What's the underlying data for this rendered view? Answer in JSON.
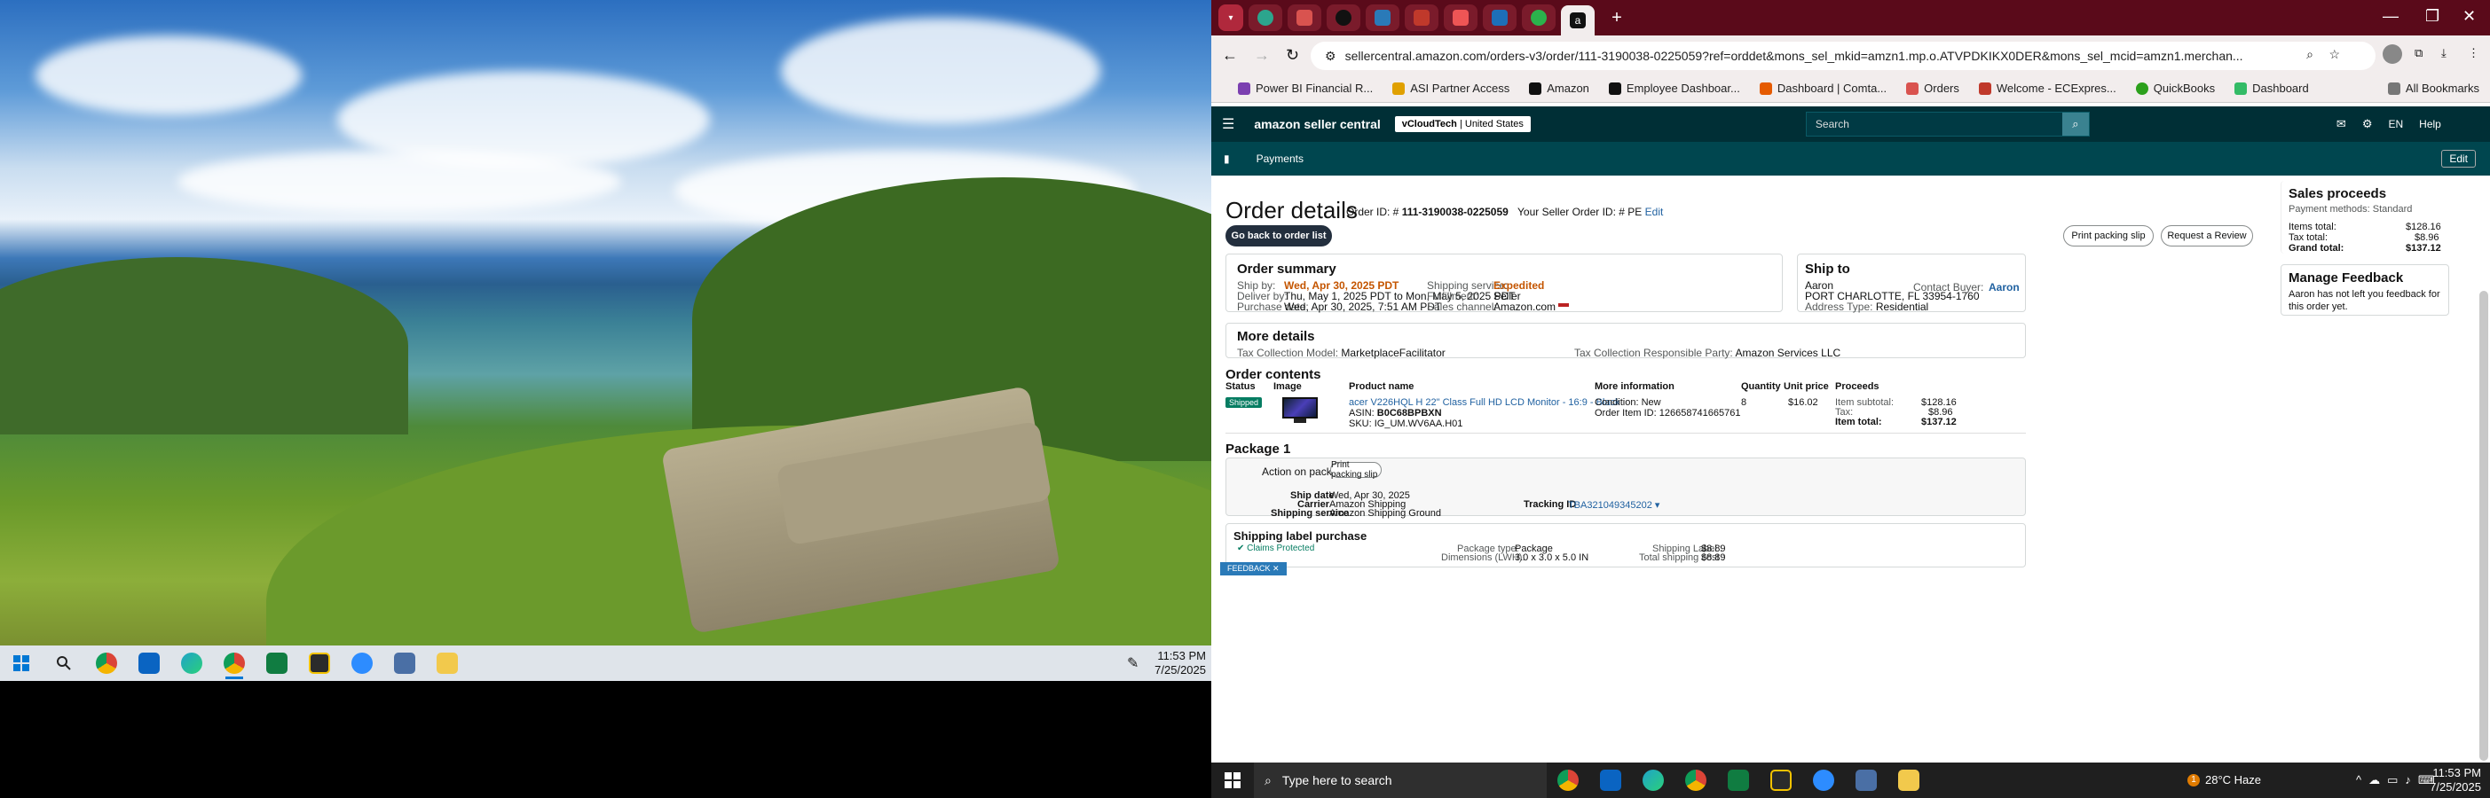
{
  "left_taskbar": {
    "time": "11:53 PM",
    "date": "7/25/2025",
    "apps": [
      "windows-icon",
      "search-icon",
      "chrome-icon",
      "outlook-icon",
      "edge-icon",
      "chrome-active-icon",
      "excel-icon",
      "sticky-icon",
      "zoom-icon",
      "calculator-icon",
      "file-explorer-icon"
    ]
  },
  "browser": {
    "url": "sellercentral.amazon.com/orders-v3/order/111-3190038-0225059?ref=orddet&mons_sel_mkid=amzn1.mp.o.ATVPDKIKX0DER&mons_sel_mcid=amzn1.merchan...",
    "bookmarks": [
      "Power BI Financial R...",
      "ASI Partner Access",
      "Amazon",
      "Employee Dashboar...",
      "Dashboard | Comta...",
      "Orders",
      "Welcome - ECExpres...",
      "QuickBooks",
      "Dashboard"
    ],
    "all_bookmarks": "All Bookmarks"
  },
  "seller": {
    "logo": "amazon seller central",
    "account": "vCloudTech",
    "marketplace": "United States",
    "search_placeholder": "Search",
    "lang": "EN",
    "help": "Help",
    "subnav_item": "Payments",
    "edit": "Edit"
  },
  "order": {
    "title": "Order details",
    "order_id_label": "Order ID: #",
    "order_id": "111-3190038-0225059",
    "seller_order_label": "Your Seller Order ID: # PE",
    "seller_order_edit": "Edit",
    "back_button": "Go back to order list",
    "print_slip": "Print packing slip",
    "request_review": "Request a Review",
    "summary_title": "Order summary",
    "ship_by_label": "Ship by:",
    "ship_by": "Wed, Apr 30, 2025 PDT",
    "deliver_by_label": "Deliver by:",
    "deliver_by": "Thu, May 1, 2025 PDT to Mon, May 5, 2025 PDT",
    "purchase_label": "Purchase date:",
    "purchase_date": "Wed, Apr 30, 2025, 7:51 AM PDT",
    "shipping_service_label": "Shipping service:",
    "shipping_service": "Expedited",
    "fulfillment_label": "Fulfillment:",
    "fulfillment": "Seller",
    "sales_channel_label": "Sales channel:",
    "sales_channel": "Amazon.com",
    "ship_to_title": "Ship to",
    "ship_name": "Aaron",
    "ship_address": "PORT CHARLOTTE, FL 33954-1760",
    "address_type_label": "Address Type:",
    "address_type": "Residential",
    "contact_buyer_label": "Contact Buyer:",
    "contact_buyer": "Aaron",
    "more_title": "More details",
    "tax_model_label": "Tax Collection Model:",
    "tax_model": "MarketplaceFacilitator",
    "tax_party_label": "Tax Collection Responsible Party:",
    "tax_party": "Amazon Services LLC",
    "contents_title": "Order contents",
    "headers": [
      "Status",
      "Image",
      "Product name",
      "More information",
      "Quantity",
      "Unit price",
      "Proceeds"
    ],
    "item": {
      "status": "Shipped",
      "product": "acer V226HQL H 22\" Class Full HD LCD Monitor - 16:9 - Black",
      "asin_label": "ASIN:",
      "asin": "B0C68BPBXN",
      "sku_label": "SKU:",
      "sku": "IG_UM.WV6AA.H01",
      "condition": "Condition: New",
      "order_item_id": "Order Item ID: 126658741665761",
      "quantity": "8",
      "unit_price": "$16.02",
      "subtotal_label": "Item subtotal:",
      "subtotal": "$128.16",
      "tax_label": "Tax:",
      "tax": "$8.96",
      "total_label": "Item total:",
      "total": "$137.12"
    },
    "package_title": "Package 1",
    "package_action": "Action on package 1",
    "package_print": "Print packing slip",
    "ship_date_label": "Ship date",
    "ship_date": "Wed, Apr 30, 2025",
    "carrier_label": "Carrier",
    "carrier": "Amazon Shipping",
    "pkg_service_label": "Shipping service",
    "pkg_service": "Amazon Shipping Ground",
    "tracking_label": "Tracking ID",
    "tracking": "TBA321049345202",
    "label_purchase_title": "Shipping label purchase",
    "claims": "Claims Protected",
    "feedback_tag": "FEEDBACK",
    "package_type_label": "Package type:",
    "package_type": "Package",
    "dimensions_label": "Dimensions (LWH):",
    "dimensions": "3.0 x 3.0 x 5.0 IN",
    "ship_label_label": "Shipping Label :",
    "ship_label": "$8.89",
    "total_ship_label": "Total shipping cost :",
    "total_ship": "$8.89"
  },
  "proceeds": {
    "title": "Sales proceeds",
    "payment": "Payment methods: Standard",
    "items_label": "Items total:",
    "items": "$128.16",
    "tax_label": "Tax total:",
    "tax": "$8.96",
    "grand_label": "Grand total:",
    "grand": "$137.12",
    "feedback_title": "Manage Feedback",
    "feedback_text": "Aaron has not left you feedback for this order yet."
  },
  "right_taskbar": {
    "search": "Type here to search",
    "weather": "28°C  Haze",
    "time": "11:53 PM",
    "date": "7/25/2025",
    "badge": "1"
  },
  "colors": {
    "accent": "#002f36",
    "link": "#2162a1",
    "orange": "#c45500",
    "tab_bar": "#5a0a1a"
  }
}
